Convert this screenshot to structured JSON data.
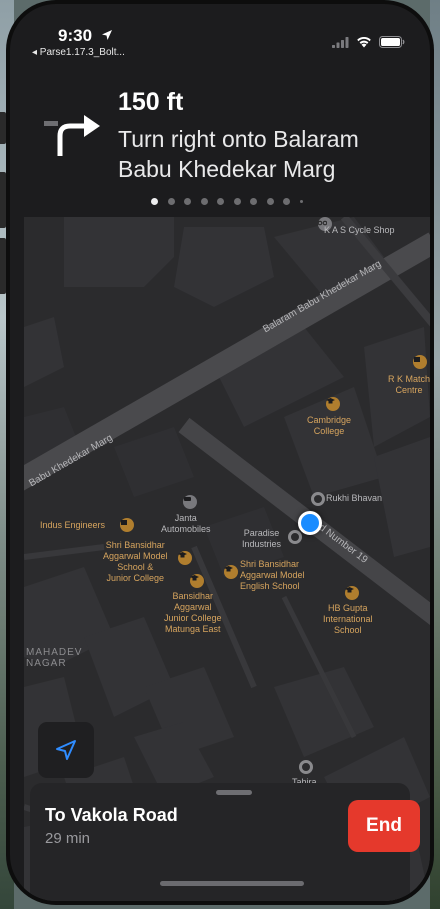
{
  "status_bar": {
    "time": "9:30",
    "back_app": "◂ Parse1.17.3_Bolt..."
  },
  "maneuver": {
    "distance": "150 ft",
    "instruction": "Turn right onto Balaram Babu Khedekar Marg",
    "step_count": 10,
    "active_step": 1
  },
  "map": {
    "roads": [
      "Balaram Babu Khedekar Marg",
      "Babu Khedekar Marg",
      "d Number 19"
    ],
    "places": [
      {
        "name": "K A S Cycle Shop",
        "color": "gray"
      },
      {
        "name": "R K Match\nCentre",
        "color": "orange"
      },
      {
        "name": "Cambridge\nCollege",
        "color": "orange"
      },
      {
        "name": "Rukhi Bhavan",
        "color": "gray"
      },
      {
        "name": "Janta\nAutomobiles",
        "color": "gray"
      },
      {
        "name": "Indus Engineers",
        "color": "orange"
      },
      {
        "name": "Paradise\nIndustries",
        "color": "gray"
      },
      {
        "name": "Shri Bansidhar\nAggarwal Model\nSchool &\nJunior College",
        "color": "orange"
      },
      {
        "name": "Shri Bansidhar\nAggarwal Model\nEnglish School",
        "color": "orange"
      },
      {
        "name": "Bansidhar\nAggarwal\nJunior College\nMatunga East",
        "color": "orange"
      },
      {
        "name": "HB Gupta\nInternational\nSchool",
        "color": "orange"
      },
      {
        "name": "Tahira",
        "color": "gray"
      }
    ],
    "area_label": "MAHADEV\nNAGAR"
  },
  "trip": {
    "destination": "To Vakola Road",
    "eta": "29 min",
    "end_label": "End"
  },
  "colors": {
    "end_button": "#e5392c",
    "user_location": "#1a8cff",
    "poi_orange": "#d6a45e"
  }
}
